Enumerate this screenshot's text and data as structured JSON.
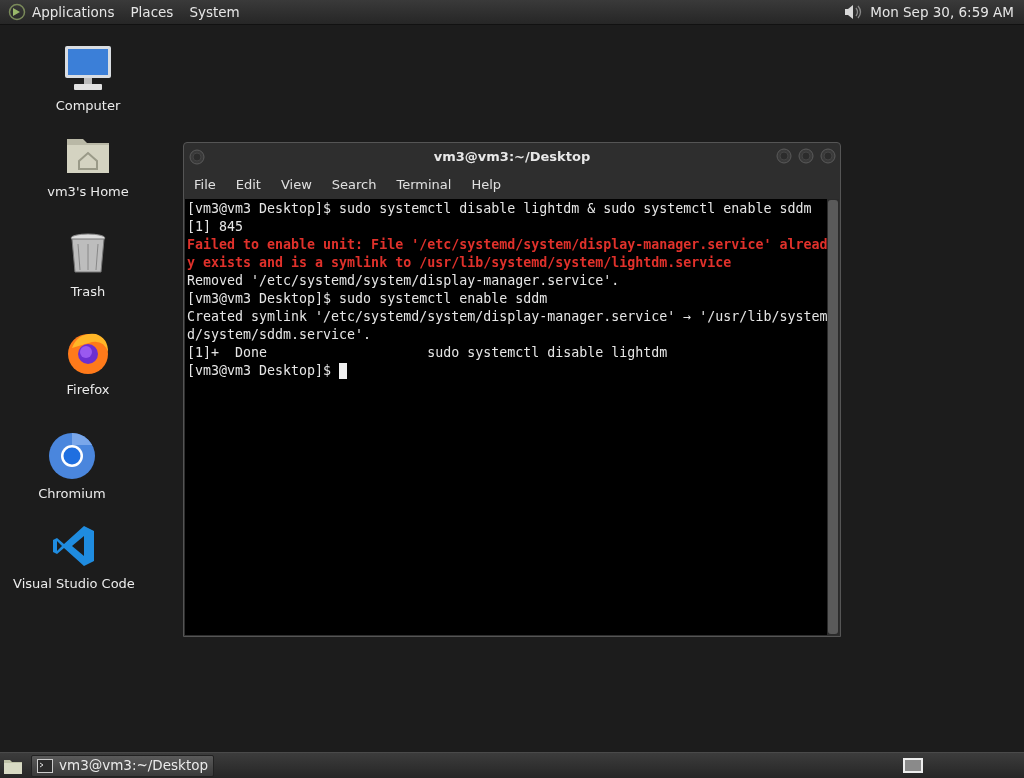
{
  "top_panel": {
    "menus": [
      "Applications",
      "Places",
      "System"
    ],
    "clock": "Mon Sep 30, 6:59 AM"
  },
  "desktop_icons": [
    {
      "kind": "computer",
      "label": "Computer"
    },
    {
      "kind": "home",
      "label": "vm3's Home"
    },
    {
      "kind": "trash",
      "label": "Trash"
    },
    {
      "kind": "firefox",
      "label": "Firefox"
    },
    {
      "kind": "chromium",
      "label": "Chromium"
    },
    {
      "kind": "vscode",
      "label": "Visual Studio Code"
    }
  ],
  "terminal": {
    "title": "vm3@vm3:~/Desktop",
    "menus": [
      "File",
      "Edit",
      "View",
      "Search",
      "Terminal",
      "Help"
    ],
    "lines": [
      {
        "kind": "normal",
        "text": "[vm3@vm3 Desktop]$ sudo systemctl disable lightdm & sudo systemctl enable sddm",
        "cursor": false
      },
      {
        "kind": "normal",
        "text": "[1] 845",
        "cursor": false
      },
      {
        "kind": "error",
        "text": "Failed to enable unit: File '/etc/systemd/system/display-manager.service' alread",
        "cursor": false
      },
      {
        "kind": "error",
        "text": "y exists and is a symlink to /usr/lib/systemd/system/lightdm.service",
        "cursor": false
      },
      {
        "kind": "normal",
        "text": "Removed '/etc/systemd/system/display-manager.service'.",
        "cursor": false
      },
      {
        "kind": "normal",
        "text": "[vm3@vm3 Desktop]$ sudo systemctl enable sddm",
        "cursor": false
      },
      {
        "kind": "normal",
        "text": "Created symlink '/etc/systemd/system/display-manager.service' → '/usr/lib/system",
        "cursor": false
      },
      {
        "kind": "normal",
        "text": "d/system/sddm.service'.",
        "cursor": false
      },
      {
        "kind": "normal",
        "text": "[1]+  Done                    sudo systemctl disable lightdm",
        "cursor": false
      },
      {
        "kind": "normal",
        "text": "[vm3@vm3 Desktop]$",
        "cursor": true
      }
    ]
  },
  "taskbar": {
    "tasks": [
      {
        "label": "vm3@vm3:~/Desktop",
        "selected": true
      }
    ]
  }
}
